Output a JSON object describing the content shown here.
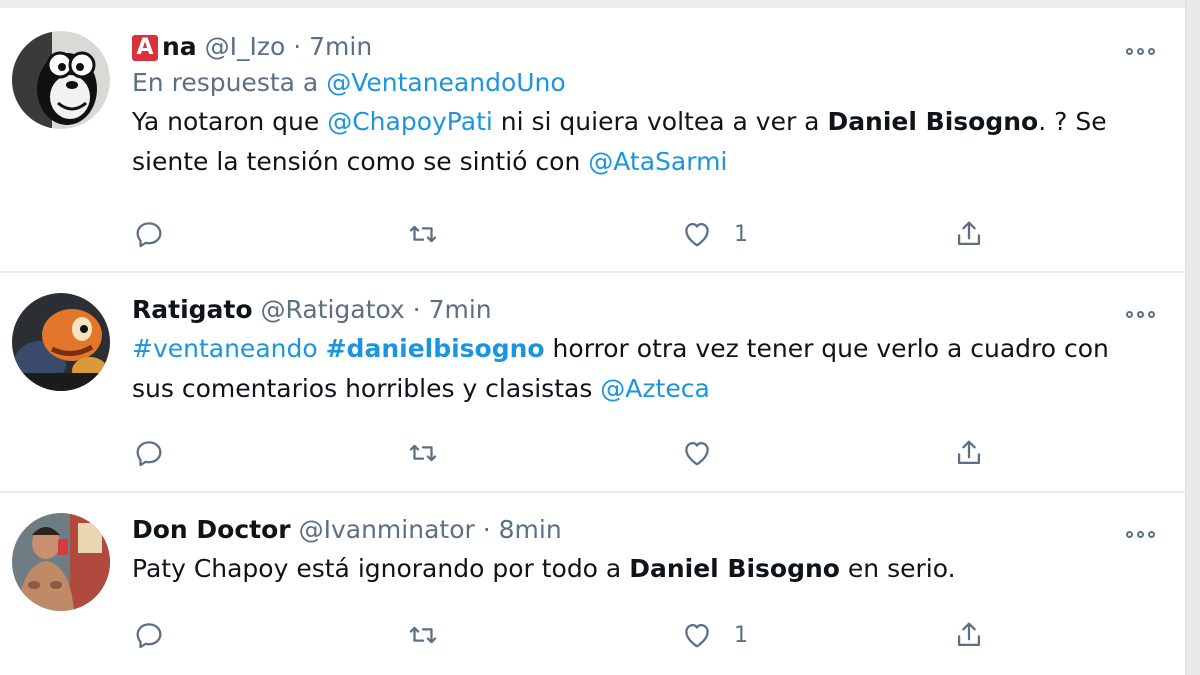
{
  "tweets": [
    {
      "badge": "A",
      "name": "na",
      "handle": "@I_Izo",
      "separator": "·",
      "time": "7min",
      "reply_prefix": "En respuesta a",
      "reply_to": "@VentaneandoUno",
      "text": {
        "t1": "Ya notaron que ",
        "m1": "@ChapoyPati",
        "t2": " ni si quiera voltea a ver a ",
        "b1": "Daniel Bisogno",
        "t3": ". ? Se siente la tensión como se sintió con ",
        "m2": "@AtaSarmi"
      },
      "likes": "1",
      "avatar_icon": "cartoon-face-avatar"
    },
    {
      "name": "Ratigato",
      "handle": "@Ratigatox",
      "separator": "·",
      "time": "7min",
      "text": {
        "h1": "#ventaneando",
        "h2": "#danielbisogno",
        "t1": " horror otra vez tener que verlo a cuadro con sus comentarios horribles y clasistas ",
        "m1": "@Azteca"
      },
      "likes": "",
      "avatar_icon": "orange-character-avatar"
    },
    {
      "name": "Don Doctor",
      "handle": "@Ivanminator",
      "separator": "·",
      "time": "8min",
      "text": {
        "t1": "Paty Chapoy está ignorando por todo a ",
        "b1": "Daniel Bisogno",
        "t2": " en serio."
      },
      "likes": "1",
      "avatar_icon": "person-photo-avatar"
    }
  ],
  "icons": {
    "reply": "reply-icon",
    "retweet": "retweet-icon",
    "like": "heart-icon",
    "share": "share-icon",
    "more": "more-icon"
  },
  "colors": {
    "link": "#1b95e0",
    "muted": "#5b7083",
    "badge": "#d9323b",
    "divider": "#e6ecf0"
  }
}
